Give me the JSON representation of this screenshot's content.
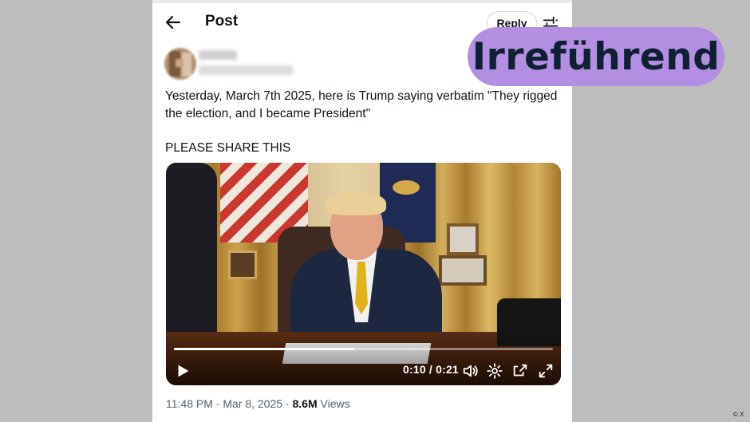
{
  "header": {
    "title": "Post",
    "reply_label": "Reply"
  },
  "tweet": {
    "text_line1": "Yesterday, March 7th 2025, here is Trump saying verbatim \"They rigged the election, and I became President\"",
    "text_line2": "PLEASE SHARE THIS",
    "timestamp": "11:48 PM · Mar 8, 2025 ·",
    "views_count": "8.6M",
    "views_label": "Views"
  },
  "video": {
    "time": "0:10 / 0:21",
    "progress": 0.476
  },
  "badge": {
    "label": "Irreführend",
    "color": "#b38fe3"
  },
  "copyright": "© X",
  "colors": {
    "text": "#0f1419",
    "secondary": "#536471",
    "background": "#bdbdbd"
  }
}
